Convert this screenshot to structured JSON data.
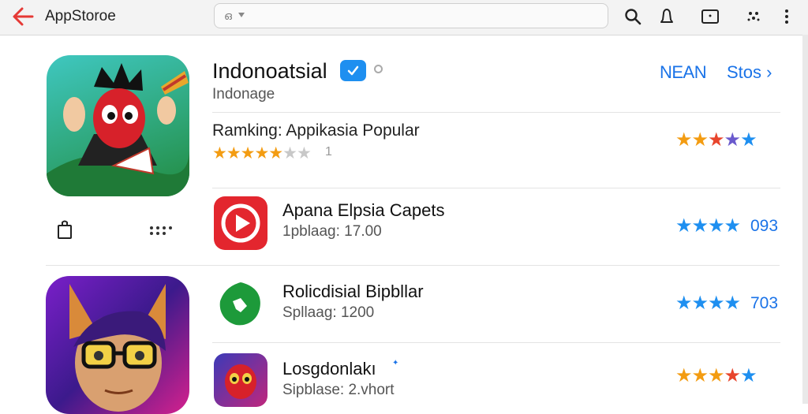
{
  "header": {
    "title": "AppStoroe",
    "search_text": "ഒ"
  },
  "featured": {
    "name": "Indonoatsial",
    "subtitle": "Indonage",
    "developer_link": "NEAN",
    "store_link": "Stos ›",
    "ranking_label": "Ramking: Appikasia Popular",
    "ranking_number": "1",
    "rating_fraction": 0.8
  },
  "apps": [
    {
      "name": "Apana Elpsia Capets",
      "subtitle": "1pblaag: 17.00",
      "rating_text": "093"
    },
    {
      "name": "Rolicdisial Bipbllar",
      "subtitle": "Spllaag: 1200",
      "rating_text": "703"
    },
    {
      "name": "Losgdonlakı",
      "subtitle": "Sipblase: 2.vhort"
    }
  ],
  "colors": {
    "accent": "#1a73e8",
    "back_arrow": "#e53935",
    "star_orange": "#f39c12",
    "star_blue": "#1e8ff0",
    "star_red": "#e8452c",
    "star_purple": "#6a5acd"
  },
  "icons": [
    "back-arrow-icon",
    "search-icon",
    "bell-icon",
    "tablet-icon",
    "dots-icon",
    "more-vert-icon",
    "share-icon",
    "more-dots-icon",
    "verified-badge-icon",
    "play-icon",
    "green-leaf-icon"
  ]
}
